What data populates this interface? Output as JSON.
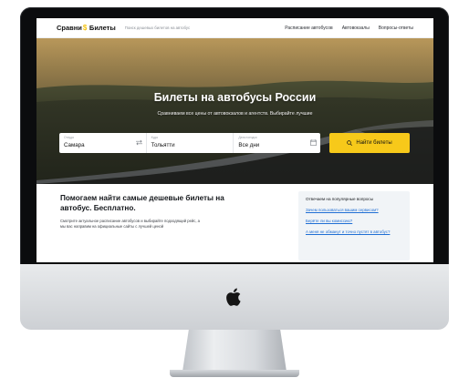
{
  "header": {
    "logo_left": "Сравни",
    "logo_right": "Билеты",
    "tagline": "Поиск дешевых билетов на автобус",
    "nav": [
      {
        "label": "Расписание автобусов"
      },
      {
        "label": "Автовокзалы"
      },
      {
        "label": "Вопросы-ответы"
      }
    ]
  },
  "hero": {
    "title": "Билеты на автобусы России",
    "subtitle": "Сравниваем все цены от автовокзалов и агентств. Выбирайте лучшие"
  },
  "search": {
    "from": {
      "label": "Откуда",
      "value": "Самара"
    },
    "to": {
      "label": "Куда",
      "value": "Тольятти"
    },
    "date": {
      "label": "Дата поездки",
      "value": "Все дни"
    },
    "button_label": "Найти билеты"
  },
  "promo": {
    "title": "Помогаем найти самые дешевые билеты на автобус. Бесплатно.",
    "text": "Смотрите актуальное расписание автобусов и выбирайте подходящий рейс, а мы вас направим на официальные сайты с лучшей ценой"
  },
  "faq": {
    "title": "Отвечаем на популярные вопросы",
    "links": [
      {
        "label": "Зачем пользоваться вашим сервисом?"
      },
      {
        "label": "Берёте ли вы комиссию?"
      },
      {
        "label": "А меня не обманут и точно пустят в автобус?"
      }
    ]
  },
  "colors": {
    "accent": "#f7c91a",
    "link": "#1f6ed4"
  },
  "icons": {
    "swap": "swap-arrows-icon",
    "calendar": "calendar-icon",
    "search": "search-icon",
    "apple": "apple-logo-icon"
  }
}
